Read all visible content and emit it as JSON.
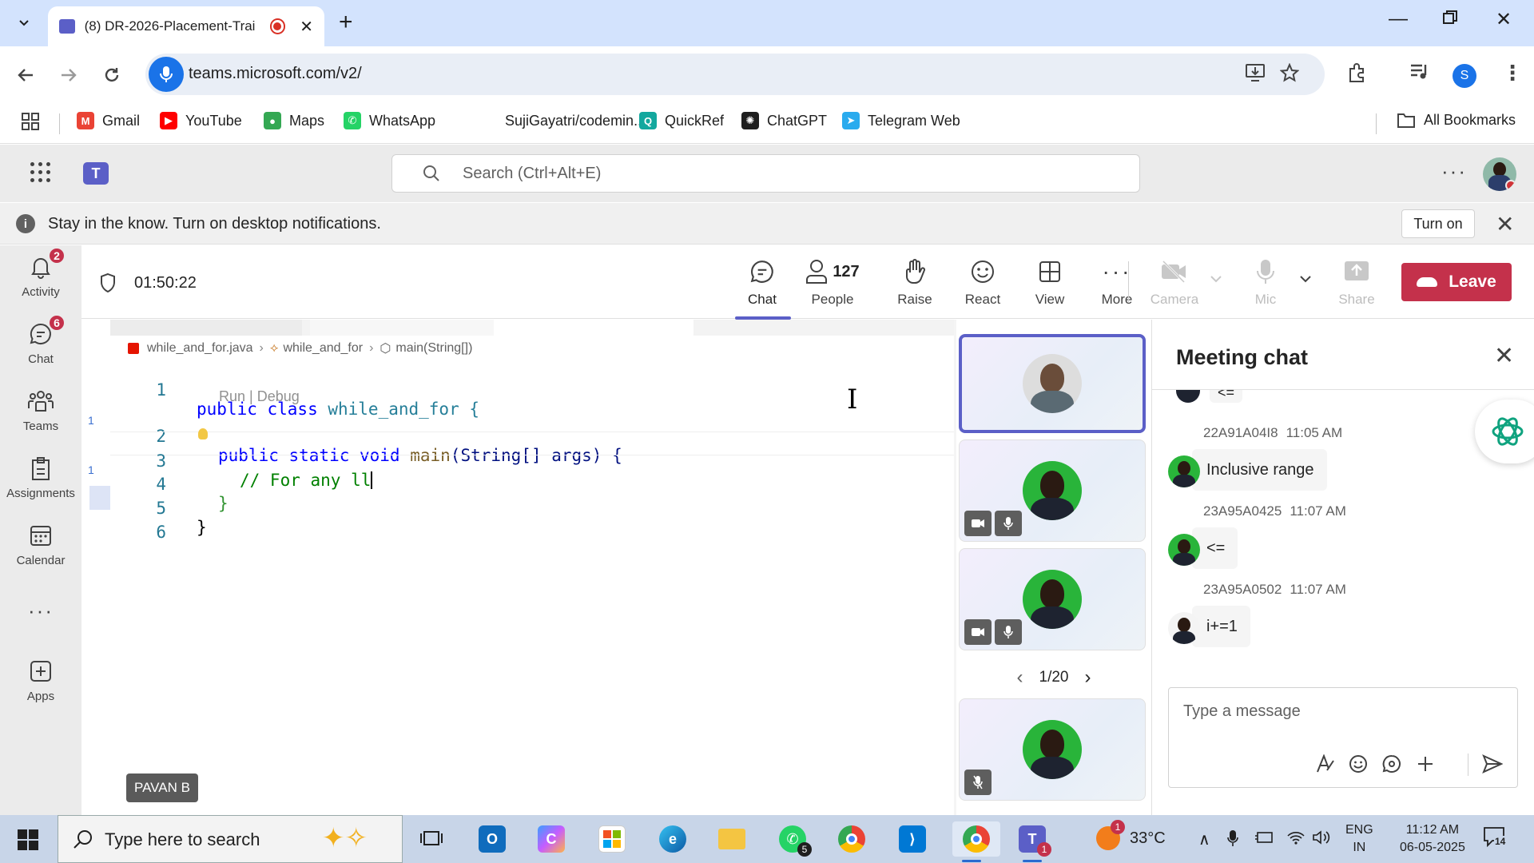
{
  "browser": {
    "tab_title": "(8) DR-2026-Placement-Trai",
    "url": "teams.microsoft.com/v2/",
    "profile_initial": "S"
  },
  "bookmarks": [
    {
      "label": "Gmail",
      "icon": "gmail-icon",
      "color": "#ea4335",
      "glyph": "M"
    },
    {
      "label": "YouTube",
      "icon": "youtube-icon",
      "color": "#ff0000",
      "glyph": "▶"
    },
    {
      "label": "Maps",
      "icon": "maps-icon",
      "color": "#34a853",
      "glyph": "●"
    },
    {
      "label": "WhatsApp",
      "icon": "whatsapp-icon",
      "color": "#25d366",
      "glyph": "✆"
    },
    {
      "label": "SujiGayatri/codemin...",
      "icon": "github-icon",
      "color": "#ffffff",
      "glyph": ""
    },
    {
      "label": "QuickRef",
      "icon": "quickref-icon",
      "color": "#13a89e",
      "glyph": "Q"
    },
    {
      "label": "ChatGPT",
      "icon": "chatgpt-icon",
      "color": "#1f1f1f",
      "glyph": "✺"
    },
    {
      "label": "Telegram Web",
      "icon": "telegram-icon",
      "color": "#2aabee",
      "glyph": "➤"
    }
  ],
  "all_bookmarks_label": "All Bookmarks",
  "teams": {
    "search_placeholder": "Search (Ctrl+Alt+E)",
    "banner_text": "Stay in the know. Turn on desktop notifications.",
    "banner_button": "Turn on"
  },
  "rail": [
    {
      "label": "Activity",
      "icon": "bell-icon",
      "badge": "2"
    },
    {
      "label": "Chat",
      "icon": "chat-icon",
      "badge": "6"
    },
    {
      "label": "Teams",
      "icon": "teams-icon",
      "badge": ""
    },
    {
      "label": "Assignments",
      "icon": "assignments-icon",
      "badge": ""
    },
    {
      "label": "Calendar",
      "icon": "calendar-icon",
      "badge": ""
    },
    {
      "label": "",
      "icon": "more-icon",
      "badge": ""
    },
    {
      "label": "Apps",
      "icon": "apps-icon",
      "badge": ""
    }
  ],
  "meeting": {
    "timer": "01:50:22",
    "controls": {
      "chat": "Chat",
      "people": "People",
      "people_count": "127",
      "raise": "Raise",
      "react": "React",
      "view": "View",
      "more": "More",
      "camera": "Camera",
      "mic": "Mic",
      "share": "Share",
      "leave": "Leave"
    }
  },
  "editor": {
    "breadcrumb": [
      "while_and_for.java",
      "while_and_for",
      "main(String[])"
    ],
    "codelens": "Run | Debug",
    "lines": [
      {
        "n": "1",
        "kw1": "public class",
        "rest": " while_and_for {"
      },
      {
        "n": "2",
        "kw1": "public static void",
        "fn": " main",
        "rest": "(String[] args) {"
      },
      {
        "n": "3",
        "comment": "// For any ll"
      },
      {
        "n": "4",
        "rest": "}"
      },
      {
        "n": "5",
        "rest": "}"
      },
      {
        "n": "6",
        "rest": ""
      }
    ],
    "gutter_marks": [
      "1",
      "1"
    ],
    "presenter": "PAVAN B"
  },
  "tiles": {
    "pager": "1/20"
  },
  "chat": {
    "title": "Meeting chat",
    "top_fragment": "<=",
    "messages": [
      {
        "sender": "22A91A04I8",
        "time": "11:05 AM",
        "text": "Inclusive range"
      },
      {
        "sender": "23A95A0425",
        "time": "11:07 AM",
        "text": "<="
      },
      {
        "sender": "23A95A0502",
        "time": "11:07 AM",
        "text": "i+=1"
      }
    ],
    "compose_placeholder": "Type a message"
  },
  "taskbar": {
    "search_placeholder": "Type here to search",
    "whatsapp_badge": "5",
    "teams_badge": "1",
    "weather_badge": "1",
    "temperature": "33°C",
    "lang_top": "ENG",
    "lang_bottom": "IN",
    "time": "11:12 AM",
    "date": "06-05-2025",
    "notifications": "14"
  },
  "colors": {
    "accent": "#5b5fc7",
    "leave": "#c4314b",
    "badge": "#c4314b"
  }
}
